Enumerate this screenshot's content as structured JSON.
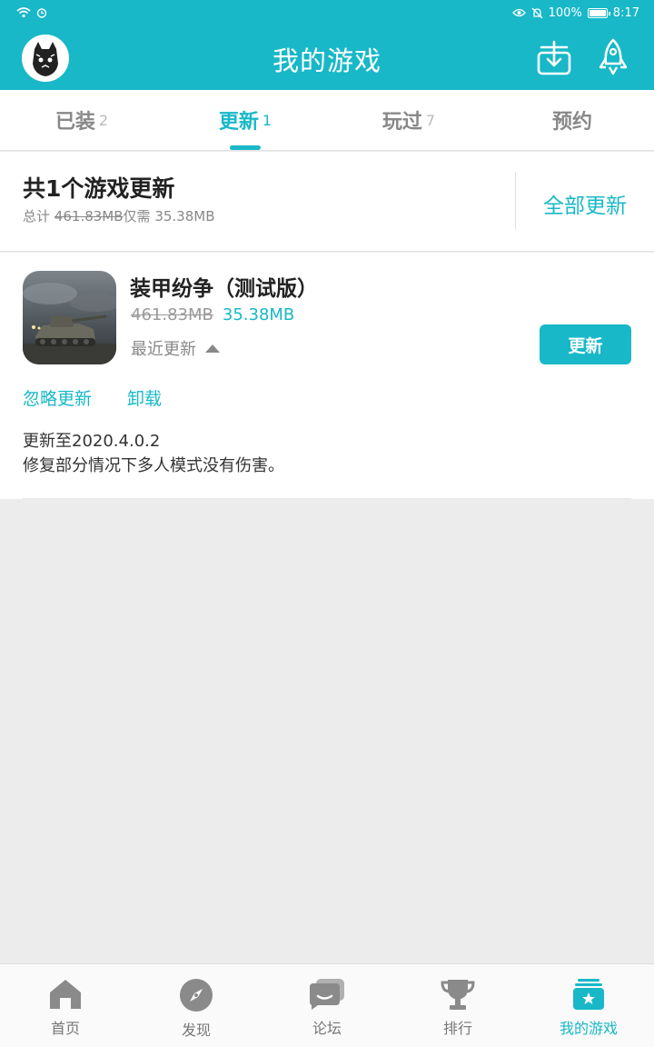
{
  "status_bar": {
    "battery": "100%",
    "time": "8:17"
  },
  "header": {
    "title": "我的游戏"
  },
  "tabs": [
    {
      "label": "已装",
      "count": "2"
    },
    {
      "label": "更新",
      "count": "1"
    },
    {
      "label": "玩过",
      "count": "7"
    },
    {
      "label": "预约",
      "count": ""
    }
  ],
  "summary": {
    "title": "共1个游戏更新",
    "total_label": "总计",
    "old_size": "461.83MB",
    "only_label": "仅需",
    "new_size": "35.38MB",
    "update_all": "全部更新"
  },
  "game": {
    "name": "装甲纷争（测试版）",
    "old_size": "461.83MB",
    "new_size": "35.38MB",
    "recent_label": "最近更新",
    "update_button": "更新",
    "ignore_link": "忽略更新",
    "uninstall_link": "卸载",
    "notes_line1": "更新至2020.4.0.2",
    "notes_line2": "修复部分情况下多人模式没有伤害。"
  },
  "bottom_nav": [
    {
      "label": "首页",
      "icon": "home-icon"
    },
    {
      "label": "发现",
      "icon": "compass-icon"
    },
    {
      "label": "论坛",
      "icon": "forum-icon"
    },
    {
      "label": "排行",
      "icon": "trophy-icon"
    },
    {
      "label": "我的游戏",
      "icon": "my-games-icon"
    }
  ],
  "colors": {
    "accent": "#18b8c8",
    "background": "#ececec"
  }
}
